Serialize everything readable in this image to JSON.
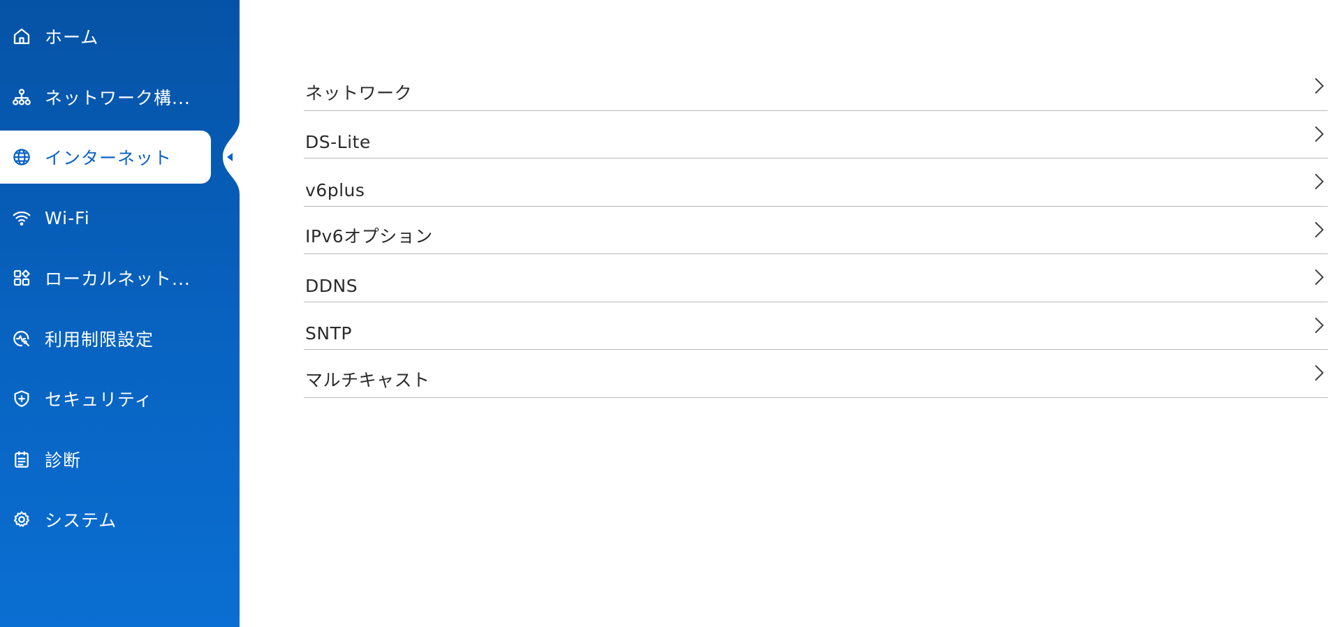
{
  "sidebar": {
    "items": [
      {
        "label": "ホーム",
        "icon": "home-icon"
      },
      {
        "label": "ネットワーク構...",
        "icon": "network-topology-icon"
      },
      {
        "label": "インターネット",
        "icon": "globe-icon",
        "active": true
      },
      {
        "label": "Wi-Fi",
        "icon": "wifi-icon"
      },
      {
        "label": "ローカルネット...",
        "icon": "apps-grid-icon"
      },
      {
        "label": "利用制限設定",
        "icon": "usage-limit-icon"
      },
      {
        "label": "セキュリティ",
        "icon": "shield-plus-icon"
      },
      {
        "label": "診断",
        "icon": "clipboard-icon"
      },
      {
        "label": "システム",
        "icon": "gear-icon"
      }
    ]
  },
  "main": {
    "items": [
      {
        "label": "ネットワーク"
      },
      {
        "label": "DS-Lite"
      },
      {
        "label": "v6plus"
      },
      {
        "label": "IPv6オプション"
      },
      {
        "label": "DDNS"
      },
      {
        "label": "SNTP"
      },
      {
        "label": "マルチキャスト"
      }
    ]
  },
  "colors": {
    "sidebar_top": "#0553a6",
    "sidebar_bottom": "#0a6fd2",
    "active_text": "#0b63c4",
    "divider": "#b9b9b9"
  }
}
